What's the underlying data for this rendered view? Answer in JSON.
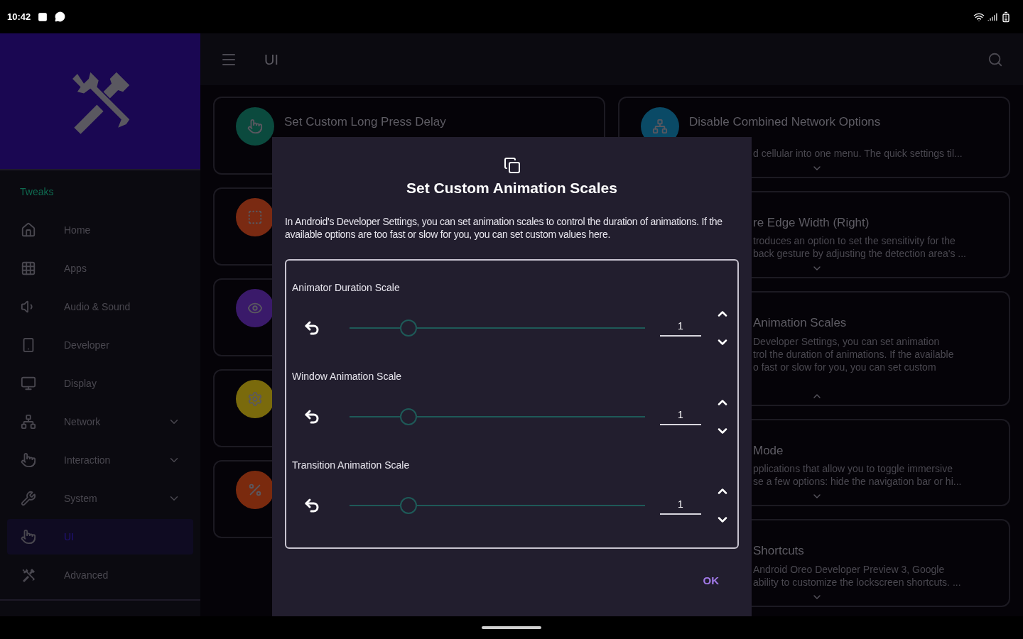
{
  "status_bar": {
    "time": "10:42"
  },
  "sidebar": {
    "section": "Tweaks",
    "items": [
      {
        "label": "Home",
        "expandable": false,
        "selected": false
      },
      {
        "label": "Apps",
        "expandable": false,
        "selected": false
      },
      {
        "label": "Audio & Sound",
        "expandable": false,
        "selected": false
      },
      {
        "label": "Developer",
        "expandable": false,
        "selected": false
      },
      {
        "label": "Display",
        "expandable": false,
        "selected": false
      },
      {
        "label": "Network",
        "expandable": true,
        "selected": false
      },
      {
        "label": "Interaction",
        "expandable": true,
        "selected": false
      },
      {
        "label": "System",
        "expandable": true,
        "selected": false
      },
      {
        "label": "UI",
        "expandable": false,
        "selected": true
      },
      {
        "label": "Advanced",
        "expandable": false,
        "selected": false
      }
    ]
  },
  "toolbar": {
    "title": "UI"
  },
  "left_cards": [
    {
      "title": "Set Custom Long Press Delay",
      "color": "#0b4a3e"
    },
    {
      "color": "#7a2a12"
    },
    {
      "color": "#3a1a6a"
    },
    {
      "color": "#7a6a0c"
    },
    {
      "color": "#7a2a0e"
    }
  ],
  "right_cards": [
    {
      "title": "Disable Combined Network Options",
      "lines": [
        "d cellular into one menu. The quick settings til..."
      ],
      "expanded": false,
      "color": "#0a4a66"
    },
    {
      "title": "re Edge Width (Right)",
      "lines": [
        "troduces an option to set the sensitivity for the",
        "back gesture by adjusting the detection area's ..."
      ],
      "expanded": false
    },
    {
      "title": "Animation Scales",
      "lines": [
        "Developer Settings, you can set animation",
        "trol the duration of animations. If the available",
        "o fast or slow for you, you can set custom"
      ],
      "expanded": true
    },
    {
      "title": "Mode",
      "lines": [
        "pplications that allow you to toggle immersive",
        "se a few options: hide the navigation bar or hi..."
      ],
      "expanded": false
    },
    {
      "title": "Shortcuts",
      "lines": [
        "Android Oreo Developer Preview 3, Google",
        "ability to customize the lockscreen shortcuts. ..."
      ],
      "expanded": false
    }
  ],
  "dialog": {
    "title": "Set Custom Animation Scales",
    "description": "In Android's Developer Settings, you can set animation scales to control the duration of animations. If the available options are too fast or slow for you, you can set custom values here.",
    "sliders": [
      {
        "label": "Animator Duration Scale",
        "level": 0.2,
        "value": "1"
      },
      {
        "label": "Window Animation Scale",
        "level": 0.2,
        "value": "1"
      },
      {
        "label": "Transition Animation Scale",
        "level": 0.2,
        "value": "1"
      }
    ],
    "button": "OK"
  }
}
